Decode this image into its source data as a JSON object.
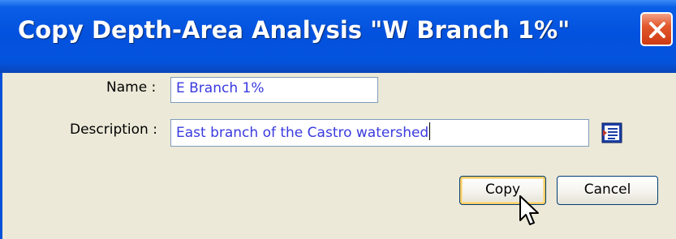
{
  "dialog": {
    "title": "Copy Depth-Area Analysis \"W Branch 1%\"",
    "close_icon": "close-icon"
  },
  "form": {
    "name_label": "Name :",
    "name_value": "E Branch 1%",
    "description_label": "Description :",
    "description_value": "East branch of the Castro watershed",
    "description_editor_icon": "text-editor-icon"
  },
  "buttons": {
    "copy_label": "Copy",
    "cancel_label": "Cancel"
  },
  "colors": {
    "titlebar": "#0352df",
    "window_bg": "#ece9d8",
    "input_text": "#3a3ae0",
    "close_button": "#e2582c",
    "focus_ring": "#f7cd62"
  }
}
